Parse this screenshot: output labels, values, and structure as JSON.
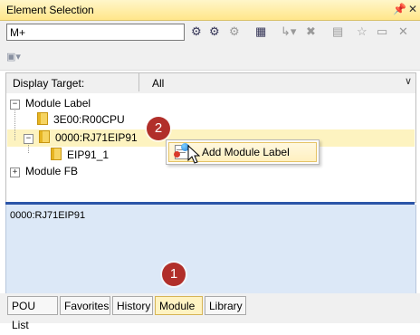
{
  "window": {
    "title": "Element Selection",
    "pin_icon": "pin-icon",
    "close_icon": "close-icon"
  },
  "search": {
    "value": "M+"
  },
  "display_target": {
    "label": "Display Target:",
    "value": "All"
  },
  "tree": {
    "module_label": "Module Label",
    "cpu_item": "3E00:R00CPU",
    "rj71_item": "0000:RJ71EIP91",
    "eip_item": "EIP91_1",
    "module_fb": "Module FB"
  },
  "context_menu": {
    "item": "Add Module Label"
  },
  "detail": {
    "text": "0000:RJ71EIP91"
  },
  "badges": {
    "step1": "1",
    "step2": "2"
  },
  "tabs": [
    "POU List",
    "Favorites",
    "History",
    "Module",
    "Library"
  ],
  "active_tab": "Module",
  "colors": {
    "title_bar": "#ffe68a",
    "badge": "#b12f2a",
    "detail_bg": "#dce8f7",
    "selection": "#fdf3c0"
  }
}
